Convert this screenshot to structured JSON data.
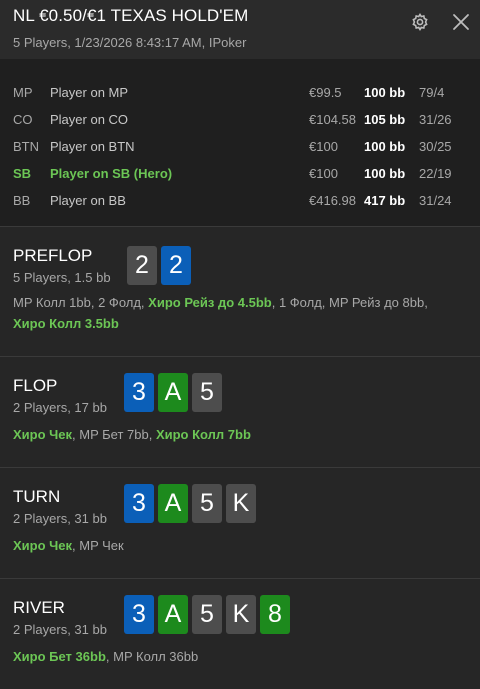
{
  "header": {
    "title": "NL €0.50/€1 TEXAS HOLD'EM",
    "subtitle": "5 Players, 1/23/2026 8:43:17 AM, IPoker",
    "settings_icon": "gear-icon",
    "close_icon": "close-icon"
  },
  "players": [
    {
      "pos": "MP",
      "name": "Player on MP",
      "stack": "€99.5",
      "bb": "100 bb",
      "stat": "79/4",
      "hero": false
    },
    {
      "pos": "CO",
      "name": "Player on CO",
      "stack": "€104.58",
      "bb": "105 bb",
      "stat": "31/26",
      "hero": false
    },
    {
      "pos": "BTN",
      "name": "Player on BTN",
      "stack": "€100",
      "bb": "100 bb",
      "stat": "30/25",
      "hero": false
    },
    {
      "pos": "SB",
      "name": "Player on SB (Hero)",
      "stack": "€100",
      "bb": "100 bb",
      "stat": "22/19",
      "hero": true
    },
    {
      "pos": "BB",
      "name": "Player on BB",
      "stack": "€416.98",
      "bb": "417 bb",
      "stat": "31/24",
      "hero": false
    }
  ],
  "colors": {
    "gray_card": "#4d4d4d",
    "blue_card": "#0b5fb8",
    "green_card": "#1d8a1d",
    "hero_text": "#6cc655"
  },
  "streets": {
    "preflop": {
      "name": "PREFLOP",
      "info": "5 Players, 1.5 bb",
      "cards": [
        {
          "rank": "2",
          "color": "gray"
        },
        {
          "rank": "2",
          "color": "blue"
        }
      ],
      "actions": [
        {
          "text": "MP Колл 1bb, ",
          "hero": false
        },
        {
          "text": "2 Фолд, ",
          "hero": false
        },
        {
          "text": "Хиро Рейз до 4.5bb",
          "hero": true
        },
        {
          "text": ", 1 Фолд, ",
          "hero": false
        },
        {
          "text": "MP Рейз до 8bb,",
          "hero": false
        },
        {
          "text": "Хиро Колл 3.5bb",
          "hero": true
        }
      ]
    },
    "flop": {
      "name": "FLOP",
      "info": "2 Players, 17 bb",
      "cards": [
        {
          "rank": "3",
          "color": "blue"
        },
        {
          "rank": "A",
          "color": "green"
        },
        {
          "rank": "5",
          "color": "gray"
        }
      ],
      "actions": [
        {
          "text": "Хиро Чек",
          "hero": true
        },
        {
          "text": ", MP Бет 7bb, ",
          "hero": false
        },
        {
          "text": "Хиро Колл 7bb",
          "hero": true
        }
      ]
    },
    "turn": {
      "name": "TURN",
      "info": "2 Players, 31 bb",
      "cards": [
        {
          "rank": "3",
          "color": "blue"
        },
        {
          "rank": "A",
          "color": "green"
        },
        {
          "rank": "5",
          "color": "gray"
        },
        {
          "rank": "K",
          "color": "gray"
        }
      ],
      "actions": [
        {
          "text": "Хиро Чек",
          "hero": true
        },
        {
          "text": ", MP Чек",
          "hero": false
        }
      ]
    },
    "river": {
      "name": "RIVER",
      "info": "2 Players, 31 bb",
      "cards": [
        {
          "rank": "3",
          "color": "blue"
        },
        {
          "rank": "A",
          "color": "green"
        },
        {
          "rank": "5",
          "color": "gray"
        },
        {
          "rank": "K",
          "color": "gray"
        },
        {
          "rank": "8",
          "color": "green"
        }
      ],
      "actions": [
        {
          "text": "Хиро Бет 36bb",
          "hero": true
        },
        {
          "text": ", MP Колл 36bb",
          "hero": false
        }
      ]
    }
  }
}
